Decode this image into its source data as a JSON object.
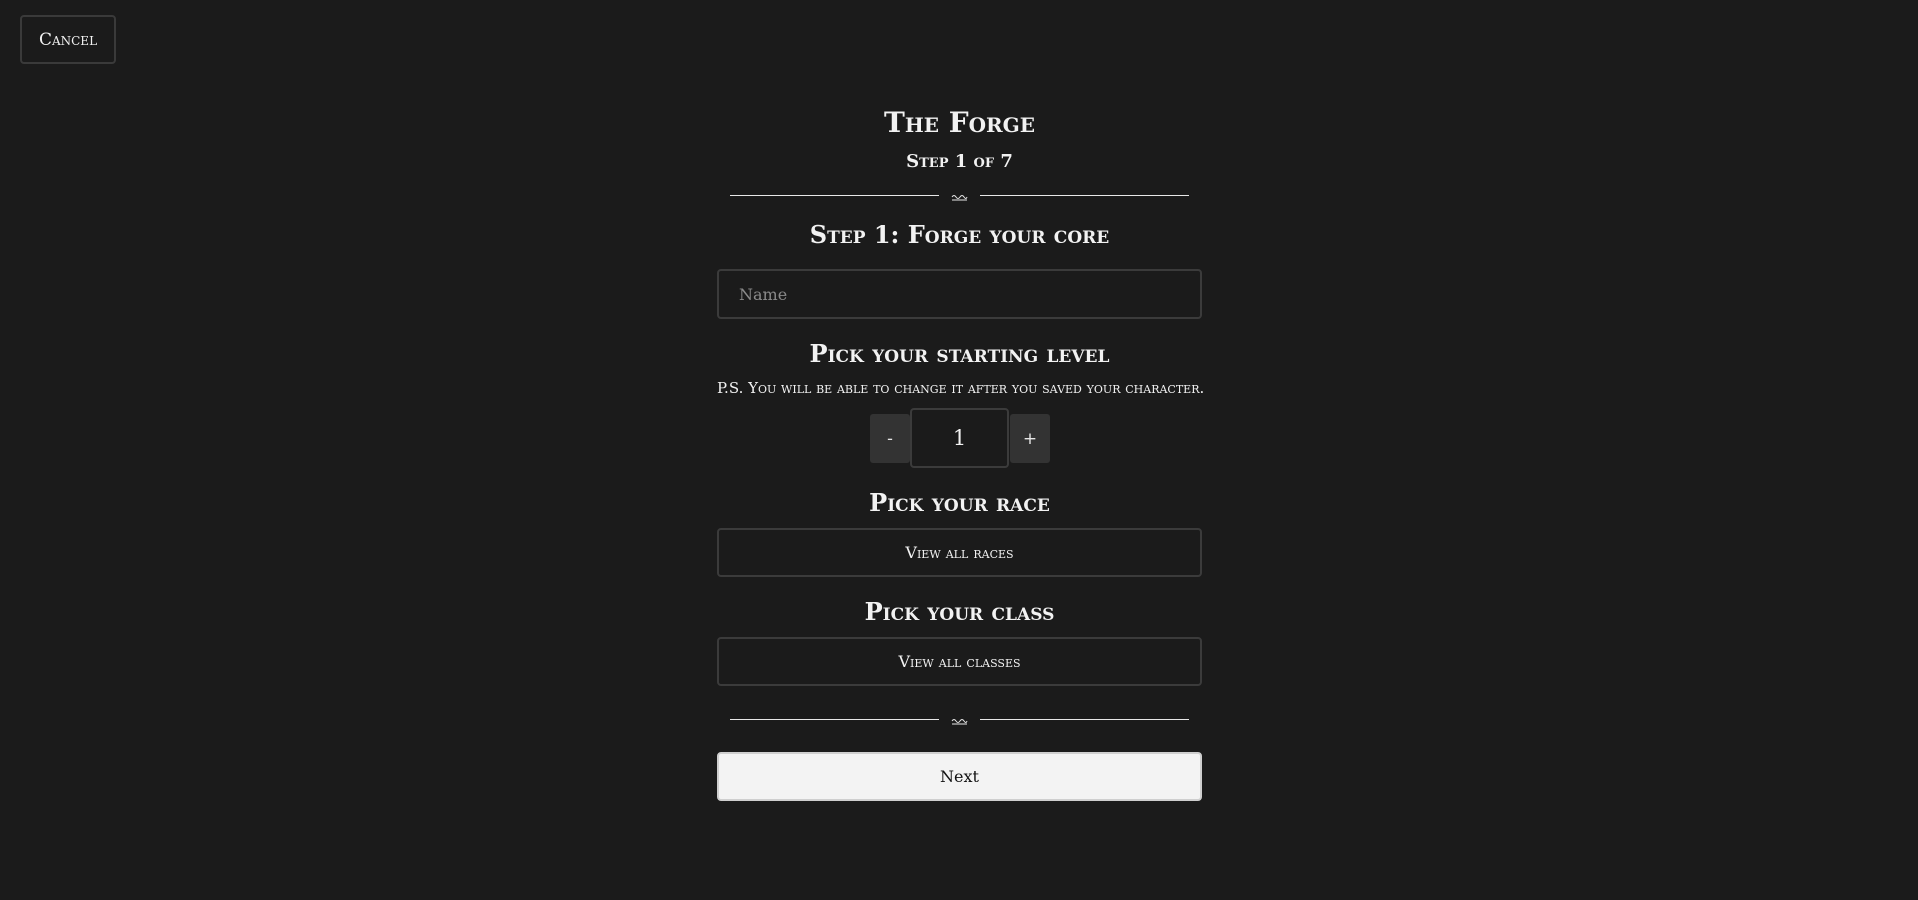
{
  "header": {
    "cancel_label": "Cancel",
    "title": "The Forge",
    "step_indicator": "Step 1 of 7"
  },
  "step": {
    "heading": "Step 1: Forge your core",
    "name_placeholder": "Name",
    "name_value": ""
  },
  "level": {
    "heading": "Pick your starting level",
    "note": "P.S. You will be able to change it after you saved your character.",
    "decrement_label": "-",
    "increment_label": "+",
    "value": "1"
  },
  "race": {
    "heading": "Pick your race",
    "button_label": "View all races"
  },
  "class": {
    "heading": "Pick your class",
    "button_label": "View all classes"
  },
  "footer": {
    "next_label": "Next"
  },
  "icons": {
    "divider_ornament": "wave-ornament-icon"
  },
  "colors": {
    "background": "#1b1b1b",
    "text": "#f2f2f2",
    "border": "#3b3b3b",
    "stepper_bg": "#333333",
    "primary_button_bg": "#f3f3f3"
  }
}
